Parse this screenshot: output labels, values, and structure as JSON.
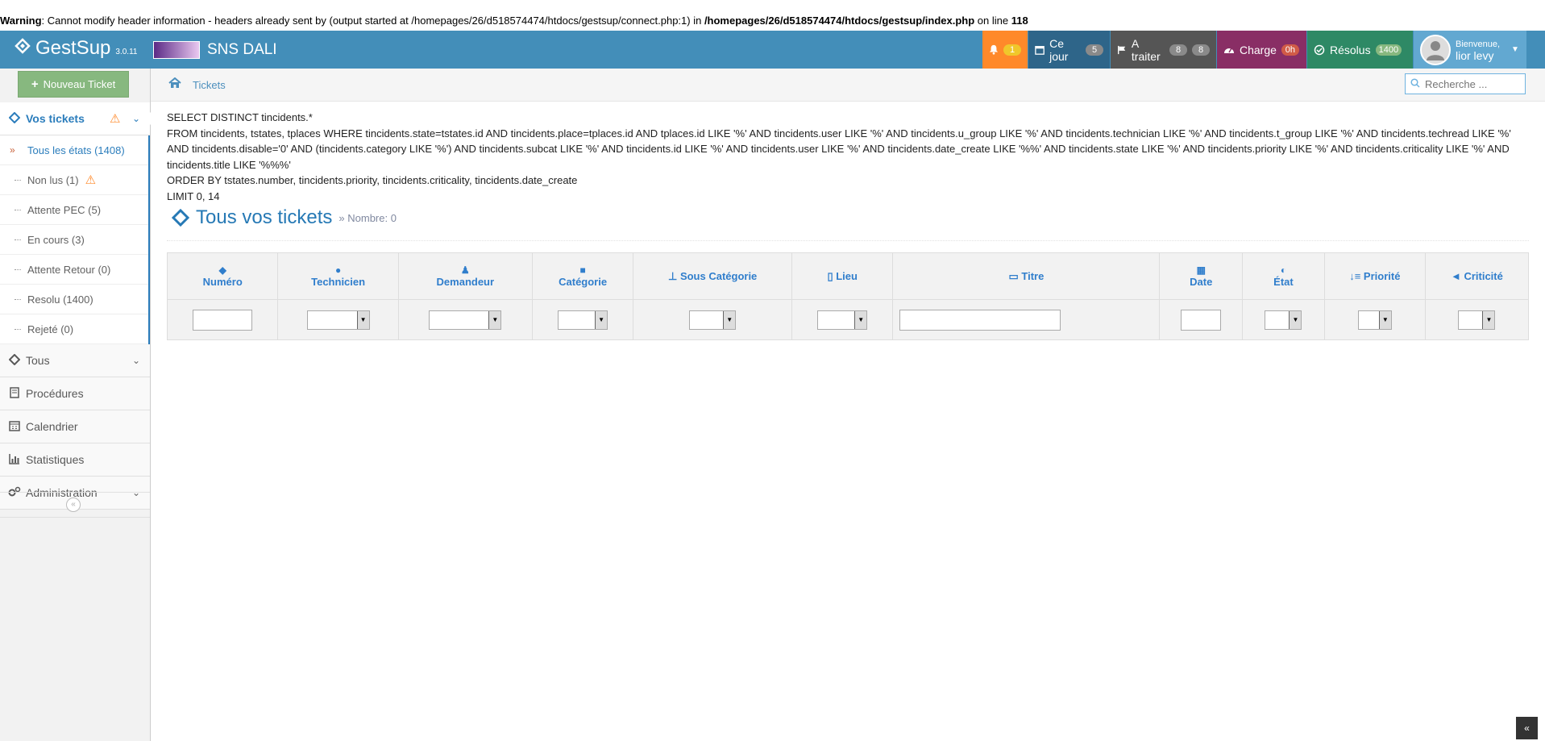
{
  "warning": {
    "label": "Warning",
    "text1": ": Cannot modify header information - headers already sent by (output started at /homepages/26/d518574474/htdocs/gestsup/connect.php:1) in ",
    "path": "/homepages/26/d518574474/htdocs/gestsup/index.php",
    "text2": " on line ",
    "line": "118"
  },
  "navbar": {
    "brand": "GestSup",
    "version": "3.0.11",
    "company": "SNS DALI",
    "bell_count": "1",
    "today_label": "Ce jour",
    "today_count": "5",
    "todo_label": "A traiter",
    "todo_count1": "8",
    "todo_count2": "8",
    "charge_label": "Charge",
    "charge_value": "0h",
    "resolved_label": "Résolus",
    "resolved_count": "1400",
    "welcome": "Bienvenue,",
    "username": "lior levy"
  },
  "sidebar": {
    "new_ticket": "Nouveau Ticket",
    "your_tickets": "Vos tickets",
    "sub": [
      "Tous les états (1408)",
      "Non lus (1)",
      "Attente PEC (5)",
      "En cours (3)",
      "Attente Retour (0)",
      "Resolu (1400)",
      "Rejeté (0)"
    ],
    "all": "Tous",
    "procedures": "Procédures",
    "calendar": "Calendrier",
    "stats": "Statistiques",
    "admin": "Administration"
  },
  "breadcrumb": {
    "tickets": "Tickets"
  },
  "search": {
    "placeholder": "Recherche ..."
  },
  "sql": [
    "SELECT DISTINCT tincidents.*",
    "FROM tincidents, tstates, tplaces WHERE tincidents.state=tstates.id AND tincidents.place=tplaces.id AND tplaces.id LIKE '%' AND tincidents.user LIKE '%' AND tincidents.u_group LIKE '%' AND tincidents.technician LIKE '%' AND tincidents.t_group LIKE '%' AND tincidents.techread LIKE '%' AND tincidents.disable='0' AND (tincidents.category LIKE '%') AND tincidents.subcat LIKE '%' AND tincidents.id LIKE '%' AND tincidents.user LIKE '%' AND tincidents.date_create LIKE '%%' AND tincidents.state LIKE '%' AND tincidents.priority LIKE '%' AND tincidents.criticality LIKE '%' AND tincidents.title LIKE '%%%'",
    "ORDER BY tstates.number, tincidents.priority, tincidents.criticality, tincidents.date_create",
    "LIMIT 0, 14"
  ],
  "page": {
    "title": "Tous vos tickets",
    "count_label": "Nombre: 0"
  },
  "columns": {
    "numero": "Numéro",
    "technicien": "Technicien",
    "demandeur": "Demandeur",
    "categorie": "Catégorie",
    "sous_categorie": "Sous Catégorie",
    "lieu": "Lieu",
    "titre": "Titre",
    "date": "Date",
    "etat": "État",
    "priorite": "Priorité",
    "criticite": "Criticité"
  },
  "icons": {
    "brand": "ticket-icon",
    "bell": "bell-icon",
    "calendar": "calendar-icon",
    "flag": "flag-icon",
    "gauge": "dashboard-icon",
    "check": "check-circle-icon",
    "home": "home-icon",
    "search": "search-icon"
  }
}
